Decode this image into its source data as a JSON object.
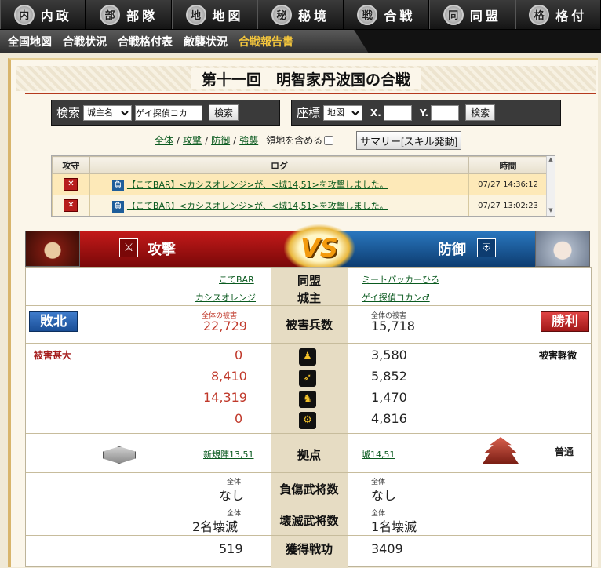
{
  "nav": {
    "items": [
      {
        "label": "内政",
        "icon": "内"
      },
      {
        "label": "部隊",
        "icon": "部"
      },
      {
        "label": "地図",
        "icon": "地"
      },
      {
        "label": "秘境",
        "icon": "秘"
      },
      {
        "label": "合戦",
        "icon": "戦"
      },
      {
        "label": "同盟",
        "icon": "同"
      },
      {
        "label": "格付",
        "icon": "格"
      }
    ]
  },
  "subnav": {
    "items": [
      "全国地図",
      "合戦状況",
      "合戦格付表",
      "敵襲状況",
      "合戦報告書"
    ],
    "active_index": 4
  },
  "page": {
    "title": "第十一回　明智家丹波国の合戦"
  },
  "search": {
    "label": "検索",
    "select_value": "城主名",
    "input_value": "ゲイ探偵コカ",
    "button": "検索"
  },
  "coords": {
    "label": "座標",
    "select_value": "地図",
    "x_label": "X.",
    "y_label": "Y.",
    "x_value": "",
    "y_value": "",
    "button": "検索"
  },
  "filters": {
    "all": "全体",
    "attack": "攻撃",
    "defense": "防御",
    "raid": "強襲",
    "include_territory": "領地を含める",
    "summary_button": "サマリー[スキル発動]"
  },
  "log": {
    "headers": {
      "side": "攻守",
      "log": "ログ",
      "time": "時間"
    },
    "rows": [
      {
        "result": "負",
        "text": "【こてBAR】<カシスオレンジ>が、<城14,51>を攻撃しました。",
        "time": "07/27 14:36:12"
      },
      {
        "result": "負",
        "text": "【こてBAR】<カシスオレンジ>が、<城14,51>を攻撃しました。",
        "time": "07/27 13:02:23"
      }
    ]
  },
  "battle": {
    "attack_label": "攻撃",
    "defense_label": "防御",
    "vs": "VS",
    "alliance_label": "同盟",
    "lord_label": "城主",
    "losses_label": "被害兵数",
    "base_label": "拠点",
    "wounded_label": "負傷武将数",
    "destroyed_label": "壊滅武将数",
    "merit_label": "獲得戦功",
    "total_loss_caption": "全体の被害",
    "total_caption": "全体",
    "attacker": {
      "alliance": "こてBAR",
      "lord": "カシスオレンジ",
      "result": "敗北",
      "total_loss": "22,729",
      "damage_level": "被害甚大",
      "unit_losses": [
        "0",
        "8,410",
        "14,319",
        "0"
      ],
      "base": "新規陣13,51",
      "wounded": "なし",
      "destroyed": "2名壊滅",
      "merit": "519"
    },
    "defender": {
      "alliance": "ミートパッカーひろ",
      "lord": "ゲイ探偵コカン♂",
      "result": "勝利",
      "total_loss": "15,718",
      "damage_level": "被害軽微",
      "unit_losses": [
        "3,580",
        "5,852",
        "1,470",
        "4,816"
      ],
      "base": "城14,51",
      "base_status": "普通",
      "wounded": "なし",
      "destroyed": "1名壊滅",
      "merit": "3409"
    },
    "unit_icons": [
      "spear-icon",
      "bow-icon",
      "horse-icon",
      "siege-icon"
    ]
  }
}
